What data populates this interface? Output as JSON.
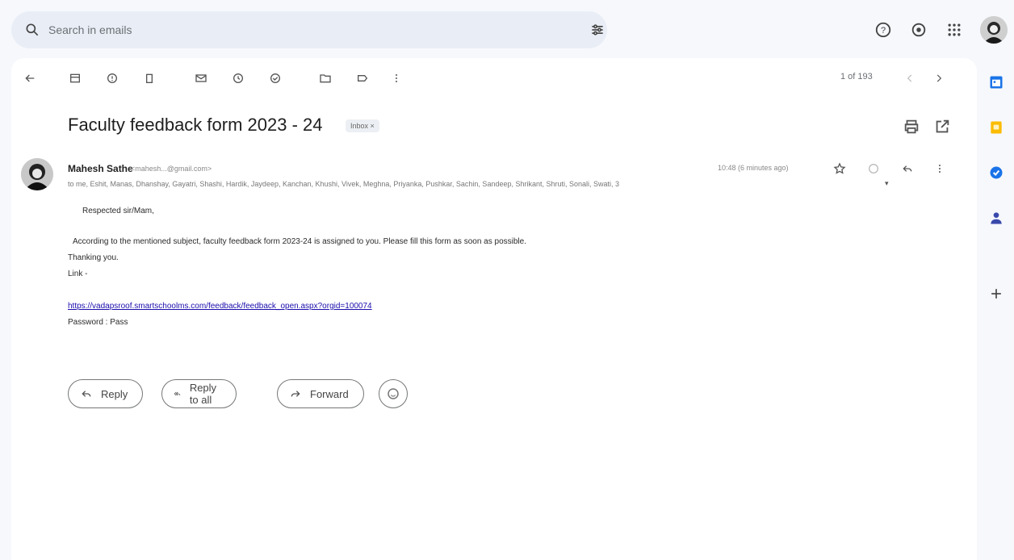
{
  "search": {
    "placeholder": "Search in emails"
  },
  "toolbar": {
    "pager": "1 of 193"
  },
  "email": {
    "subject": "Faculty feedback form 2023 - 24",
    "label": "Inbox ×",
    "sender_name": "Mahesh Sathe",
    "sender_email": "<mahesh...@gmail.com>",
    "timestamp": "10:48 (6 minutes ago)",
    "recipients": "to me, Eshit, Manas, Dhanshay, Gayatri, Shashi, Hardik, Jaydeep, Kanchan, Khushi, Vivek, Meghna, Priyanka, Pushkar, Sachin, Sandeep, Shrikant, Shruti, Sonali, Swati, 3",
    "greeting": "Respected sir/Mam,",
    "line1": "According to the mentioned subject, faculty feedback form 2023-24 is assigned to you. Please fill this form as soon as possible.",
    "line2": "Thanking you.",
    "line3": "Link -",
    "link": "https://vadapsroof.smartschoolms.com/feedback/feedback_open.aspx?orgid=100074",
    "password": "Password : Pass"
  },
  "actions": {
    "reply": "Reply",
    "reply_all": "Reply to all",
    "forward": "Forward"
  },
  "colors": {
    "background": "#f6f8fc",
    "search_bg": "#e9eef6",
    "panel": "#ffffff",
    "link": "#1a0dab",
    "calendar_icon": "#1a73e8",
    "keep_icon": "#fbbc04",
    "tasks_icon": "#1a73e8",
    "contacts_icon": "#3949ab"
  }
}
